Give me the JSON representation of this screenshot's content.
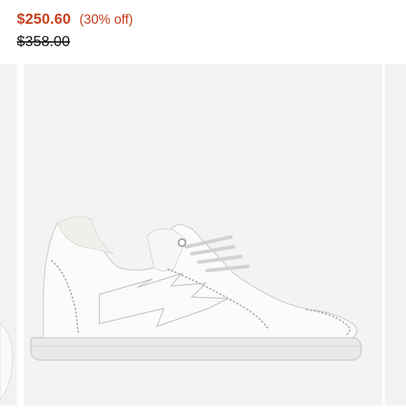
{
  "price": {
    "sale": "$250.60",
    "discount": "(30% off)",
    "original": "$358.00"
  },
  "gallery": {
    "main_image_alt": "White leather sneaker with lightning bolt and studded trim",
    "colors": {
      "sale": "#c8401f",
      "image_bg": "#f3f3f3"
    }
  }
}
